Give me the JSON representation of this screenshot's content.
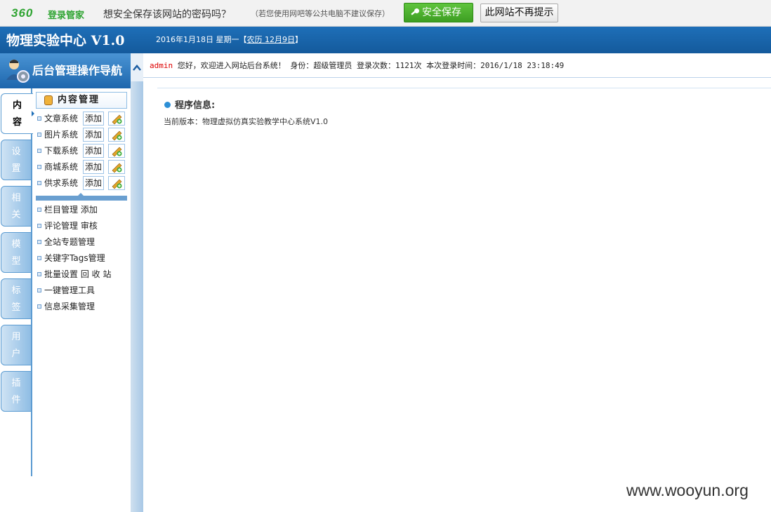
{
  "password_bar": {
    "logo": "360",
    "logo_name": "登录管家",
    "question": "想安全保存该网站的密码吗？",
    "hint": "（若您使用网吧等公共电脑不建议保存）",
    "save_label": "安全保存",
    "never_label": "此网站不再提示",
    "colors": {
      "save": "#3d9e22",
      "brand": "#2fa432"
    }
  },
  "header": {
    "title": "物理实验中心 V1.0",
    "date": "2016年1月18日 星期一【",
    "lunar": "农历 12月9日",
    "date_end": "】"
  },
  "nav": {
    "title": "后台管理操作导航",
    "tabs": [
      {
        "label": "内容"
      },
      {
        "label": "设置"
      },
      {
        "label": "相关"
      },
      {
        "label": "模型"
      },
      {
        "label": "标签"
      },
      {
        "label": "用户"
      },
      {
        "label": "插件"
      }
    ],
    "menu_head": "内容管理",
    "systems": [
      {
        "label": "文章系统",
        "add": "添加"
      },
      {
        "label": "图片系统",
        "add": "添加"
      },
      {
        "label": "下载系统",
        "add": "添加"
      },
      {
        "label": "商城系统",
        "add": "添加"
      },
      {
        "label": "供求系统",
        "add": "添加"
      }
    ],
    "links": [
      "栏目管理 添加",
      "评论管理 审核",
      "全站专题管理",
      "关键字Tags管理",
      "批量设置 回 收 站",
      "一键管理工具",
      "信息采集管理"
    ]
  },
  "welcome": {
    "user": "admin",
    "text": " 您好，欢迎进入网站后台系统！ 身份：超级管理员 登录次数：1121次 本次登录时间：2016/1/18 23:18:49"
  },
  "content": {
    "section_title": "程序信息:",
    "version_text": "当前版本：物理虚拟仿真实验教学中心系统V1.0"
  },
  "watermark": "www.wooyun.org"
}
